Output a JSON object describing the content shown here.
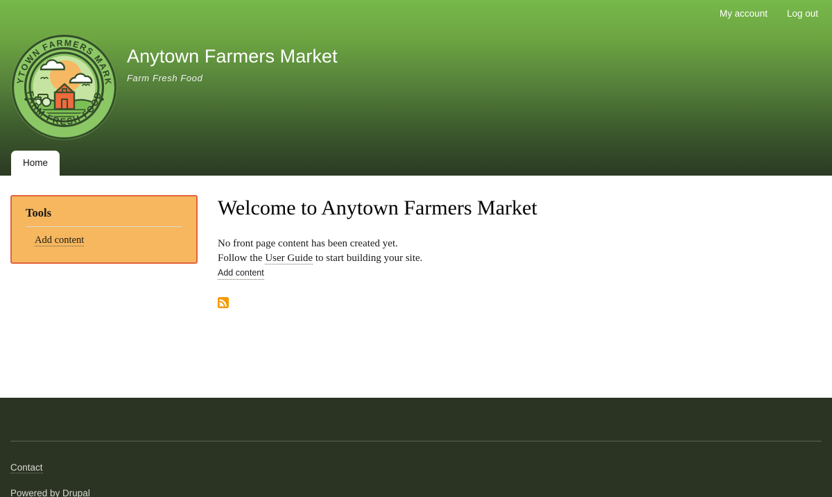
{
  "header": {
    "site_name": "Anytown Farmers Market",
    "site_slogan": "Farm Fresh Food",
    "user_links": [
      {
        "label": "My account"
      },
      {
        "label": "Log out"
      }
    ],
    "logo": {
      "icon": "farmers-market-badge-logo",
      "arc_text_top": "ANYTOWN FARMERS MARKET",
      "arc_text_bottom": "FARM FRESH FOOD",
      "colors": {
        "ring_outer": "#3f6130",
        "ring_inner": "#8cc765",
        "sky": "#bfe09a",
        "sun": "#f7b863",
        "barn": "#ef6a3d",
        "cloud": "#ffffff",
        "field": "#7cbf55"
      }
    },
    "gradient": {
      "top": "#77b94a",
      "bottom": "#2c3a24"
    }
  },
  "tabs": [
    {
      "label": "Home",
      "active": true
    }
  ],
  "sidebar": {
    "blocks": [
      {
        "title": "Tools",
        "links": [
          {
            "label": "Add content"
          }
        ],
        "background": "#f6b75f",
        "border": "#e4633b"
      }
    ]
  },
  "main": {
    "page_title": "Welcome to Anytown Farmers Market",
    "line_1": "No front page content has been created yet.",
    "line_2_prefix": "Follow the ",
    "line_2_link": "User Guide",
    "line_2_suffix": " to start building your site.",
    "add_content_label": "Add content",
    "feed_icon": "rss-feed-icon",
    "feed_icon_color": "#f59b00"
  },
  "footer": {
    "menu": [
      {
        "label": "Contact"
      }
    ],
    "powered_prefix": "Powered by ",
    "powered_link": "Drupal",
    "background": "#2b3323"
  }
}
